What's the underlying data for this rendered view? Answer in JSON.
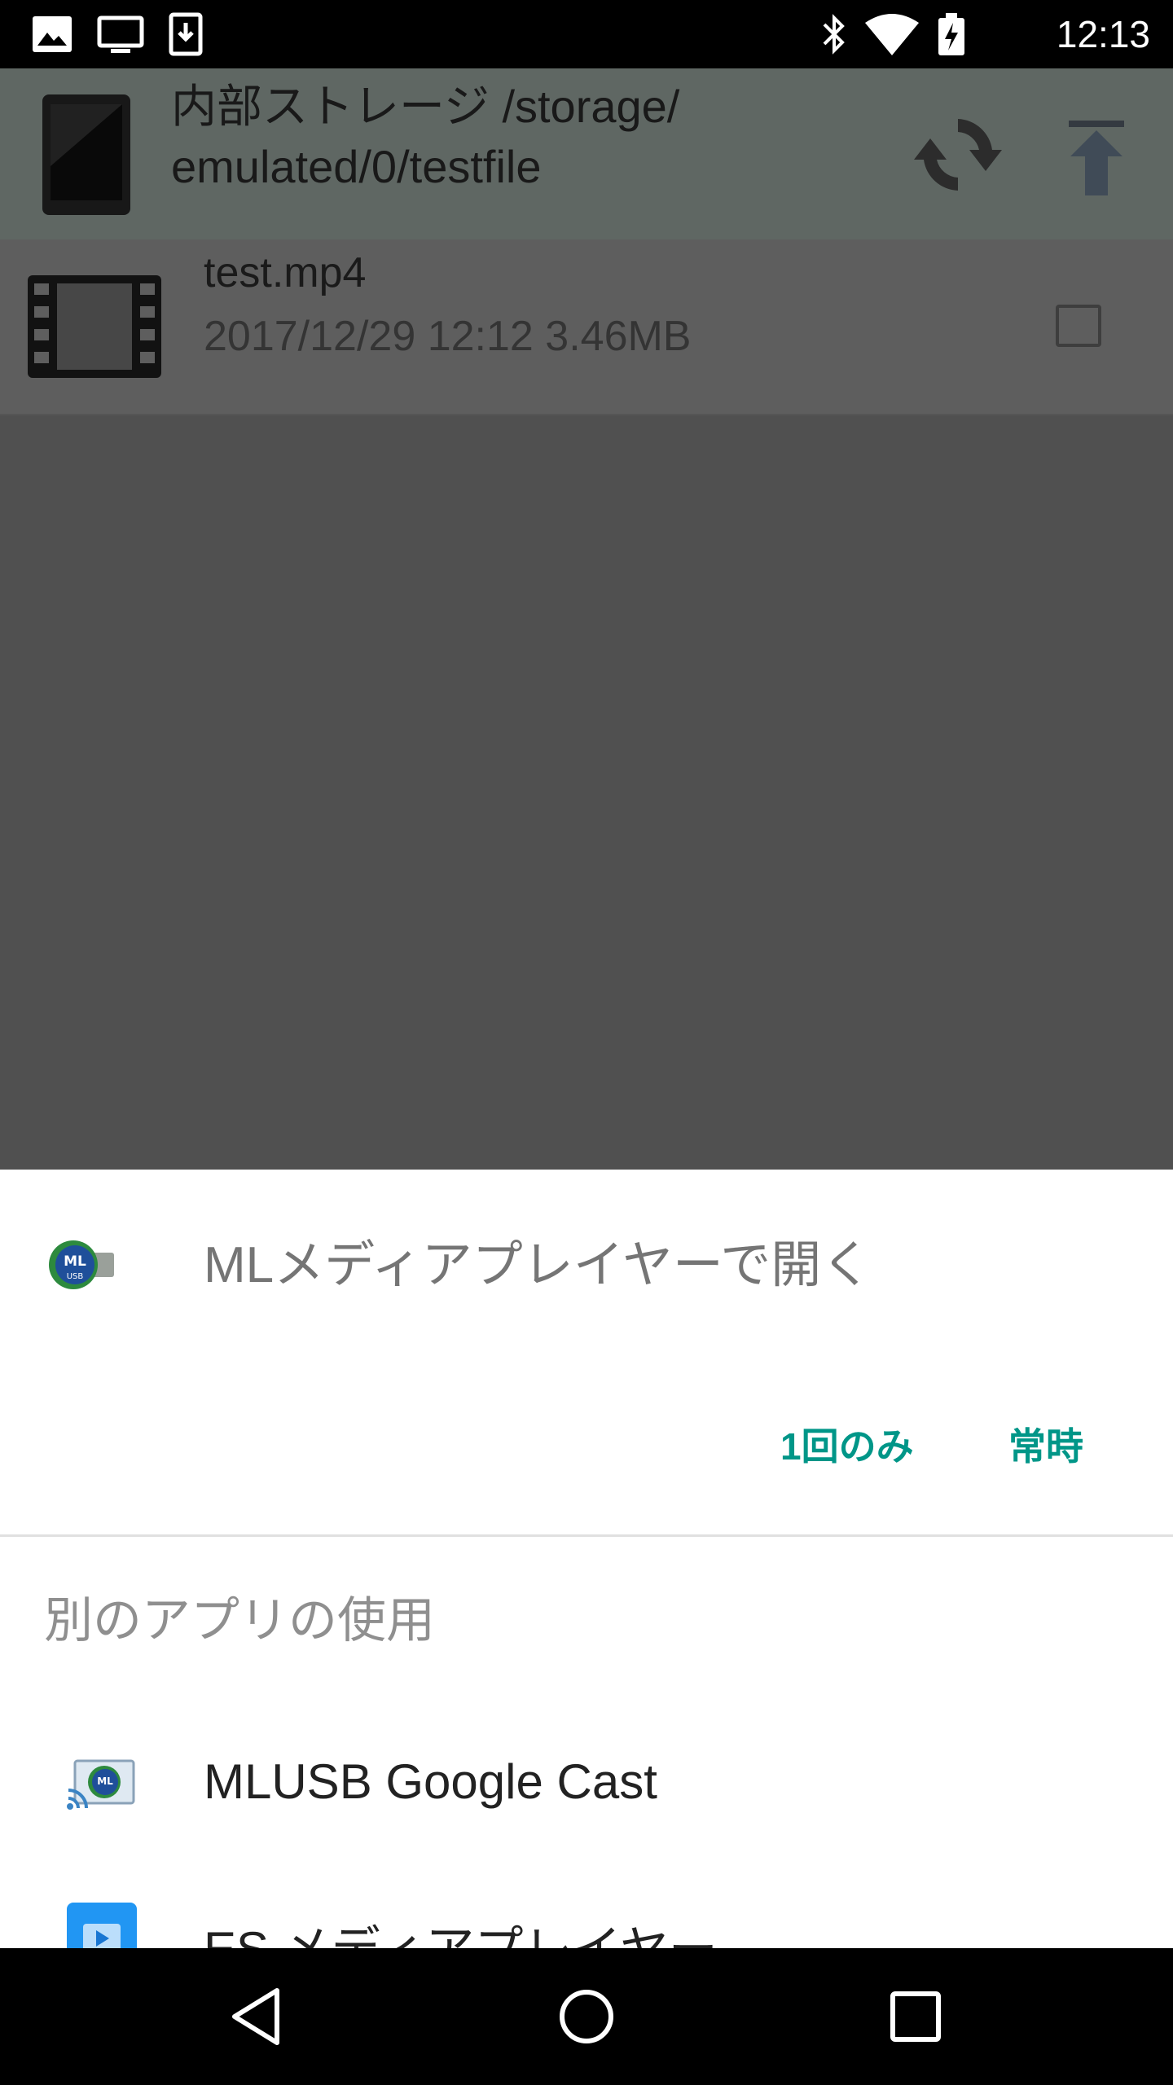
{
  "status_bar": {
    "time": "12:13",
    "icons_left": [
      "image-icon",
      "cast-screen-icon",
      "download-icon"
    ],
    "icons_right": [
      "bluetooth-icon",
      "wifi-icon",
      "battery-charging-icon"
    ]
  },
  "header": {
    "path": "内部ストレージ /storage/ emulated/0/testfile",
    "icons": [
      "tablet-icon",
      "refresh-icon",
      "upload-icon"
    ]
  },
  "files": [
    {
      "name": "test.mp4",
      "meta": "2017/12/29 12:12 3.46MB",
      "checked": false
    }
  ],
  "sheet": {
    "default_app_title": "MLメディアプレイヤーで開く",
    "btn_once": "1回のみ",
    "btn_always": "常時",
    "other_apps_label": "別のアプリの使用",
    "other_apps": [
      {
        "label": "MLUSB Google Cast",
        "icon": "mlusb-cast-icon"
      },
      {
        "label": "ES メディアプレイヤー",
        "icon": "es-player-icon"
      }
    ]
  },
  "colors": {
    "accent": "#009688",
    "header_bg": "#a4b1ab",
    "status_bar": "#000000"
  }
}
